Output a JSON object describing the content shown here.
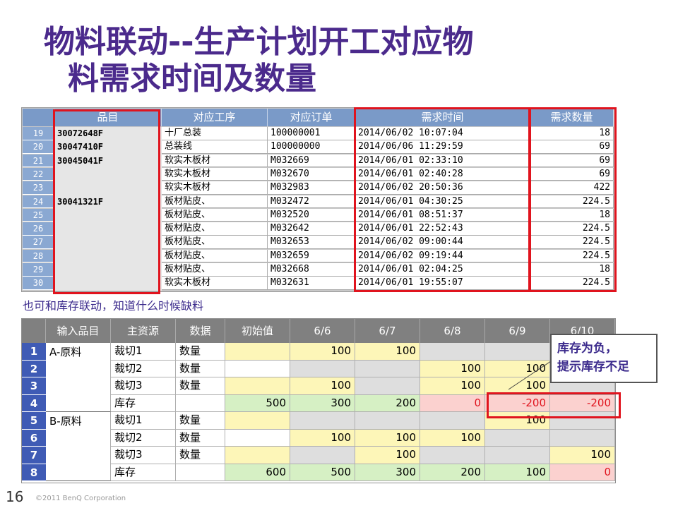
{
  "title": {
    "line1": "物料联动--生产计划开工对应物",
    "line2": "料需求时间及数量"
  },
  "table1": {
    "headers": [
      "品目",
      "对应工序",
      "对应订单",
      "需求时间",
      "需求数量"
    ],
    "row_numbers": [
      "19",
      "20",
      "21",
      "22",
      "23",
      "24",
      "25",
      "26",
      "27",
      "28",
      "29",
      "30"
    ],
    "items": [
      {
        "label": "30072648F",
        "row": 0
      },
      {
        "label": "30047410F",
        "row": 1
      },
      {
        "label": "30045041F",
        "row": 2
      },
      {
        "label": "30041321F",
        "row": 5
      }
    ],
    "rows": [
      [
        "十厂总装",
        "100000001",
        "2014/06/02 10:07:04",
        "18"
      ],
      [
        "总装线",
        "100000000",
        "2014/06/06 11:29:59",
        "69"
      ],
      [
        "软实木板材",
        "M032669",
        "2014/06/01 02:33:10",
        "69"
      ],
      [
        "软实木板材",
        "M032670",
        "2014/06/01 02:40:28",
        "69"
      ],
      [
        "软实木板材",
        "M032983",
        "2014/06/02 20:50:36",
        "422"
      ],
      [
        "板材贴皮、",
        "M032472",
        "2014/06/01 04:30:25",
        "224.5"
      ],
      [
        "板材贴皮、",
        "M032520",
        "2014/06/01 08:51:37",
        "18"
      ],
      [
        "板材贴皮、",
        "M032642",
        "2014/06/01 22:52:43",
        "224.5"
      ],
      [
        "板材贴皮、",
        "M032653",
        "2014/06/02 09:00:44",
        "224.5"
      ],
      [
        "板材贴皮、",
        "M032659",
        "2014/06/02 09:19:44",
        "224.5"
      ],
      [
        "板材贴皮、",
        "M032668",
        "2014/06/01 02:04:25",
        "18"
      ],
      [
        "软实木板材",
        "M032631",
        "2014/06/01 19:55:07",
        "224.5"
      ]
    ]
  },
  "note": "也可和库存联动，知道什么时候缺料",
  "table2": {
    "headers": [
      "输入品目",
      "主资源",
      "数据",
      "初始值",
      "6/6",
      "6/7",
      "6/8",
      "6/9",
      "6/10"
    ],
    "row_numbers": [
      "1",
      "2",
      "3",
      "4",
      "5",
      "6",
      "7",
      "8"
    ],
    "groups": [
      "A-原料",
      "B-原料"
    ],
    "rows": [
      {
        "res": "裁切1",
        "data": "数量",
        "vals": [
          "",
          "100",
          "100",
          "",
          "",
          ""
        ],
        "cls": [
          "y",
          "y",
          "y",
          "g",
          "g",
          "g"
        ]
      },
      {
        "res": "裁切2",
        "data": "数量",
        "vals": [
          "",
          "",
          "",
          "100",
          "100",
          ""
        ],
        "cls": [
          "w",
          "g",
          "g",
          "y",
          "y",
          "g"
        ]
      },
      {
        "res": "裁切3",
        "data": "数量",
        "vals": [
          "",
          "100",
          "",
          "100",
          "100",
          ""
        ],
        "cls": [
          "y",
          "y",
          "g",
          "y",
          "y",
          "g"
        ]
      },
      {
        "res": "库存",
        "data": "",
        "vals": [
          "500",
          "300",
          "200",
          "0",
          "-200",
          "-200"
        ],
        "cls": [
          "gr",
          "gr",
          "gr",
          "pk",
          "pk",
          "pk"
        ]
      },
      {
        "res": "裁切1",
        "data": "数量",
        "vals": [
          "",
          "",
          "",
          "",
          "100",
          ""
        ],
        "cls": [
          "y",
          "g",
          "g",
          "g",
          "y",
          "g"
        ]
      },
      {
        "res": "裁切2",
        "data": "数量",
        "vals": [
          "",
          "100",
          "100",
          "100",
          "",
          ""
        ],
        "cls": [
          "w",
          "y",
          "y",
          "y",
          "g",
          "g"
        ]
      },
      {
        "res": "裁切3",
        "data": "数量",
        "vals": [
          "",
          "",
          "100",
          "",
          "",
          "100"
        ],
        "cls": [
          "y",
          "g",
          "y",
          "g",
          "g",
          "y"
        ]
      },
      {
        "res": "库存",
        "data": "",
        "vals": [
          "600",
          "500",
          "300",
          "200",
          "100",
          "0"
        ],
        "cls": [
          "gr",
          "gr",
          "gr",
          "gr",
          "gr",
          "pk"
        ]
      }
    ]
  },
  "callout": {
    "line1": "库存为负，",
    "line2": "提示库存不足"
  },
  "footer": {
    "page": "16",
    "copyright": "©2011 BenQ Corporation"
  },
  "colors": {
    "title": "#4b2a8c",
    "highlight_box": "#e0141e",
    "header_blue": "#7a9ac8",
    "row_number_blue": "#3f5bb5"
  }
}
